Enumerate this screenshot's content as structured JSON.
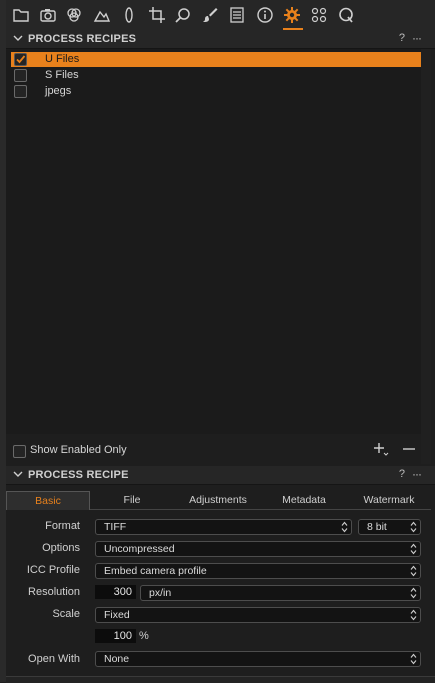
{
  "toolbar": {
    "icons": [
      "folder-icon",
      "camera-icon",
      "color-circles-icon",
      "exposure-icon",
      "lens-icon",
      "crop-icon",
      "search-icon",
      "brush-icon",
      "metadata-list-icon",
      "info-icon",
      "gear-icon",
      "styles-icon",
      "quick-icon"
    ],
    "active": "gear-icon",
    "accent": "#e8811c"
  },
  "recipes_panel": {
    "title": "PROCESS RECIPES",
    "help": "?",
    "more": "···",
    "items": [
      {
        "label": "U Files",
        "checked": true,
        "selected": true
      },
      {
        "label": "S Files",
        "checked": false,
        "selected": false
      },
      {
        "label": "jpegs",
        "checked": false,
        "selected": false
      }
    ],
    "show_enabled_only": "Show Enabled Only"
  },
  "recipe_panel": {
    "title": "PROCESS RECIPE",
    "help": "?",
    "more": "···",
    "tabs": [
      "Basic",
      "File",
      "Adjustments",
      "Metadata",
      "Watermark"
    ],
    "active_tab": "Basic",
    "fields": {
      "format_label": "Format",
      "format_value": "TIFF",
      "bit_value": "8 bit",
      "options_label": "Options",
      "options_value": "Uncompressed",
      "icc_label": "ICC Profile",
      "icc_value": "Embed camera profile",
      "resolution_label": "Resolution",
      "resolution_value": "300",
      "resolution_unit": "px/in",
      "scale_label": "Scale",
      "scale_value": "Fixed",
      "scale_percent": "100",
      "percent_sign": "%",
      "open_with_label": "Open With",
      "open_with_value": "None"
    }
  }
}
